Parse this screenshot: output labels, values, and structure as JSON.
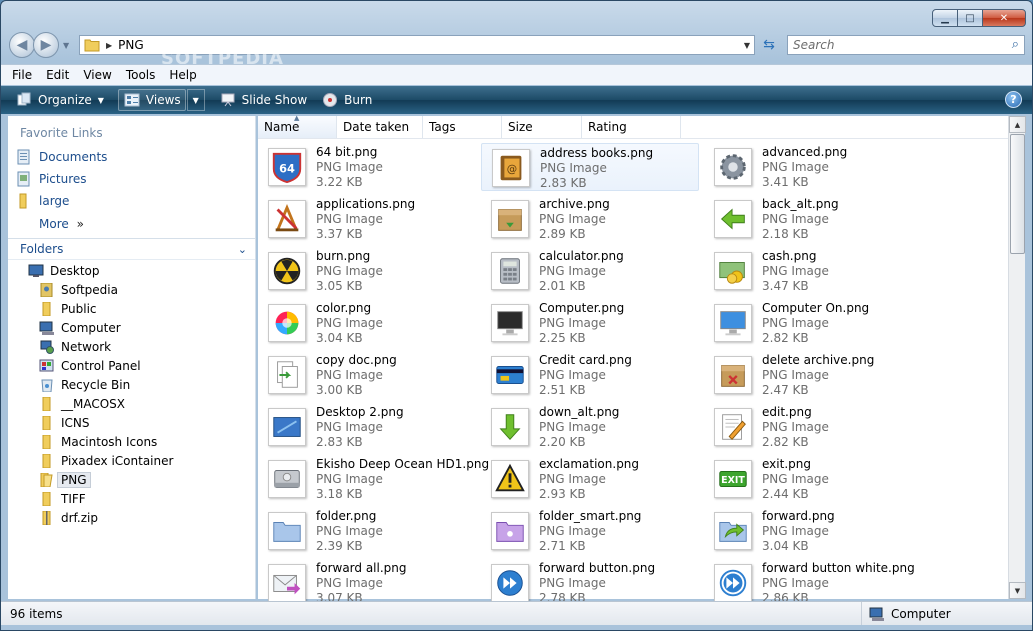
{
  "window": {
    "minimize": "▁",
    "maximize": "□",
    "close": "✕"
  },
  "address": {
    "path": "PNG"
  },
  "search": {
    "placeholder": "Search"
  },
  "watermark": "SOFTPEDIA",
  "menu": [
    "File",
    "Edit",
    "View",
    "Tools",
    "Help"
  ],
  "toolbar": {
    "organize": "Organize",
    "views": "Views",
    "slideshow": "Slide Show",
    "burn": "Burn",
    "help": "?"
  },
  "favorites": {
    "heading": "Favorite Links",
    "items": [
      "Documents",
      "Pictures",
      "large"
    ],
    "more": "More",
    "more_icon": "»"
  },
  "folders": {
    "heading": "Folders",
    "items": [
      "Desktop",
      "Softpedia",
      "Public",
      "Computer",
      "Network",
      "Control Panel",
      "Recycle Bin",
      "__MACOSX",
      "ICNS",
      "Macintosh Icons",
      "Pixadex iContainer",
      "PNG",
      "TIFF",
      "drf.zip"
    ]
  },
  "columns": [
    "Name",
    "Date taken",
    "Tags",
    "Size",
    "Rating"
  ],
  "files": [
    {
      "name": "64 bit.png",
      "type": "PNG Image",
      "size": "3.22 KB",
      "icon": "64-bit-shield-icon"
    },
    {
      "name": "address books.png",
      "type": "PNG Image",
      "size": "2.83 KB",
      "icon": "address-book-icon"
    },
    {
      "name": "advanced.png",
      "type": "PNG Image",
      "size": "3.41 KB",
      "icon": "gear-icon"
    },
    {
      "name": "applications.png",
      "type": "PNG Image",
      "size": "3.37 KB",
      "icon": "applications-icon"
    },
    {
      "name": "archive.png",
      "type": "PNG Image",
      "size": "2.89 KB",
      "icon": "archive-box-icon"
    },
    {
      "name": "back_alt.png",
      "type": "PNG Image",
      "size": "2.18 KB",
      "icon": "back-arrow-icon"
    },
    {
      "name": "burn.png",
      "type": "PNG Image",
      "size": "3.05 KB",
      "icon": "burn-hazard-icon"
    },
    {
      "name": "calculator.png",
      "type": "PNG Image",
      "size": "2.01 KB",
      "icon": "calculator-icon"
    },
    {
      "name": "cash.png",
      "type": "PNG Image",
      "size": "3.47 KB",
      "icon": "cash-icon"
    },
    {
      "name": "color.png",
      "type": "PNG Image",
      "size": "3.04 KB",
      "icon": "color-wheel-icon"
    },
    {
      "name": "Computer.png",
      "type": "PNG Image",
      "size": "2.25 KB",
      "icon": "monitor-off-icon"
    },
    {
      "name": "Computer On.png",
      "type": "PNG Image",
      "size": "2.82 KB",
      "icon": "monitor-on-icon"
    },
    {
      "name": "copy doc.png",
      "type": "PNG Image",
      "size": "3.00 KB",
      "icon": "copy-doc-icon"
    },
    {
      "name": "Credit card.png",
      "type": "PNG Image",
      "size": "2.51 KB",
      "icon": "credit-card-icon"
    },
    {
      "name": "delete archive.png",
      "type": "PNG Image",
      "size": "2.47 KB",
      "icon": "delete-archive-icon"
    },
    {
      "name": "Desktop 2.png",
      "type": "PNG Image",
      "size": "2.83 KB",
      "icon": "desktop-icon"
    },
    {
      "name": "down_alt.png",
      "type": "PNG Image",
      "size": "2.20 KB",
      "icon": "down-arrow-icon"
    },
    {
      "name": "edit.png",
      "type": "PNG Image",
      "size": "2.82 KB",
      "icon": "edit-pencil-icon"
    },
    {
      "name": "Ekisho Deep Ocean HD1.png",
      "type": "PNG Image",
      "size": "3.18 KB",
      "icon": "hard-drive-icon"
    },
    {
      "name": "exclamation.png",
      "type": "PNG Image",
      "size": "2.93 KB",
      "icon": "warning-icon"
    },
    {
      "name": "exit.png",
      "type": "PNG Image",
      "size": "2.44 KB",
      "icon": "exit-sign-icon"
    },
    {
      "name": "folder.png",
      "type": "PNG Image",
      "size": "2.39 KB",
      "icon": "folder-icon"
    },
    {
      "name": "folder_smart.png",
      "type": "PNG Image",
      "size": "2.71 KB",
      "icon": "smart-folder-icon"
    },
    {
      "name": "forward.png",
      "type": "PNG Image",
      "size": "3.04 KB",
      "icon": "forward-folder-icon"
    },
    {
      "name": "forward all.png",
      "type": "PNG Image",
      "size": "3.07 KB",
      "icon": "forward-all-mail-icon"
    },
    {
      "name": "forward button.png",
      "type": "PNG Image",
      "size": "2.78 KB",
      "icon": "forward-button-icon"
    },
    {
      "name": "forward button white.png",
      "type": "PNG Image",
      "size": "2.86 KB",
      "icon": "forward-button-white-icon"
    }
  ],
  "status": {
    "count": "96 items",
    "location": "Computer"
  }
}
